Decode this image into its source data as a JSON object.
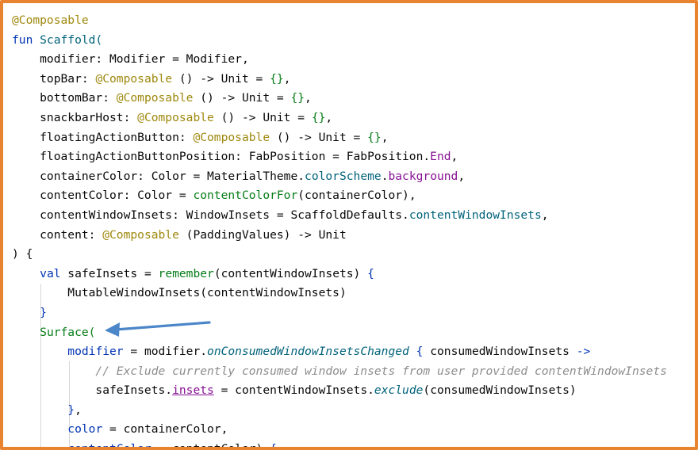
{
  "accent_colors": {
    "frame_border": "#e8832f",
    "annotation_arrow": "#4a86c8"
  },
  "code": {
    "l1": "@Composable",
    "l2_kw": "fun",
    "l2_name": " Scaffold(",
    "l3": "    modifier: Modifier = Modifier,",
    "l4_a": "    topBar: ",
    "l4_anno": "@Composable",
    "l4_b": " () -> Unit = ",
    "l4_c": "{}",
    "l4_d": ",",
    "l5_a": "    bottomBar: ",
    "l5_anno": "@Composable",
    "l5_b": " () -> Unit = ",
    "l5_c": "{}",
    "l5_d": ",",
    "l6_a": "    snackbarHost: ",
    "l6_anno": "@Composable",
    "l6_b": " () -> Unit = ",
    "l6_c": "{}",
    "l6_d": ",",
    "l7_a": "    floatingActionButton: ",
    "l7_anno": "@Composable",
    "l7_b": " () -> Unit = ",
    "l7_c": "{}",
    "l7_d": ",",
    "l8_a": "    floatingActionButtonPosition: FabPosition = FabPosition.",
    "l8_b": "End",
    "l8_c": ",",
    "l9_a": "    containerColor: Color = MaterialTheme.",
    "l9_b": "colorScheme",
    "l9_c": ".",
    "l9_d": "background",
    "l9_e": ",",
    "l10_a": "    contentColor: Color = ",
    "l10_b": "contentColorFor",
    "l10_c": "(containerColor),",
    "l11_a": "    contentWindowInsets: WindowInsets = ScaffoldDefaults.",
    "l11_b": "contentWindowInsets",
    "l11_c": ",",
    "l12_a": "    content: ",
    "l12_anno": "@Composable",
    "l12_b": " (PaddingValues) -> Unit",
    "l13": ") {",
    "l14_a": "    ",
    "l14_kw": "val",
    "l14_b": " safeInsets = ",
    "l14_c": "remember",
    "l14_d": "(contentWindowInsets) ",
    "l14_e": "{",
    "l15": "        MutableWindowInsets(contentWindowInsets)",
    "l16": "    }",
    "l17_a": "    ",
    "l17_b": "Surface(",
    "l18_a": "        ",
    "l18_b": "modifier",
    "l18_c": " = modifier.",
    "l18_d": "onConsumedWindowInsetsChanged",
    "l18_e": " ",
    "l18_f": "{",
    "l18_g": " consumedWindowInsets ",
    "l18_h": "->",
    "l19": "            // Exclude currently consumed window insets from user provided contentWindowInsets",
    "l20_a": "            safeInsets.",
    "l20_b": "insets",
    "l20_c": " = contentWindowInsets.",
    "l20_d": "exclude",
    "l20_e": "(consumedWindowInsets)",
    "l21_a": "        ",
    "l21_b": "}",
    "l21_c": ",",
    "l22_a": "        ",
    "l22_b": "color",
    "l22_c": " = containerColor,",
    "l23_a": "        ",
    "l23_b": "contentColor",
    "l23_c": " = contentColor) ",
    "l23_d": "{"
  }
}
